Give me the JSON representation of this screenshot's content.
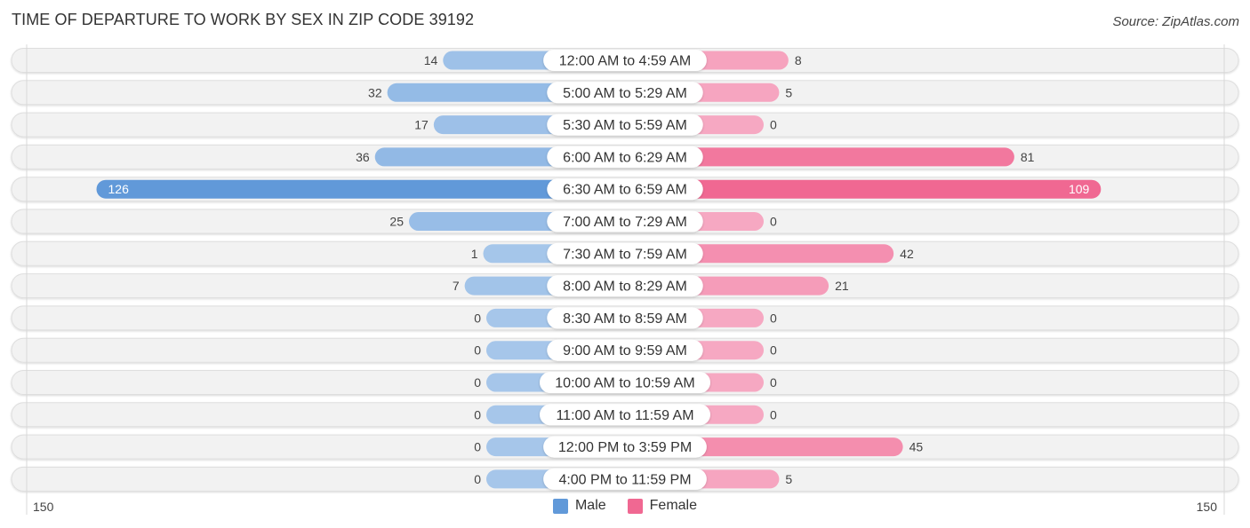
{
  "header": {
    "title": "TIME OF DEPARTURE TO WORK BY SEX IN ZIP CODE 39192",
    "source": "Source: ZipAtlas.com"
  },
  "colors": {
    "male_strong": "#6199d9",
    "male_light": "#a6c6ea",
    "female_strong": "#f06892",
    "female_light": "#f6a8c2",
    "row_bg": "#f2f2f2"
  },
  "legend": [
    {
      "label": "Male",
      "color": "#6199d9"
    },
    {
      "label": "Female",
      "color": "#f06892"
    }
  ],
  "chart_data": {
    "type": "bar",
    "orientation": "horizontal-diverging",
    "title": "TIME OF DEPARTURE TO WORK BY SEX IN ZIP CODE 39192",
    "categories": [
      "12:00 AM to 4:59 AM",
      "5:00 AM to 5:29 AM",
      "5:30 AM to 5:59 AM",
      "6:00 AM to 6:29 AM",
      "6:30 AM to 6:59 AM",
      "7:00 AM to 7:29 AM",
      "7:30 AM to 7:59 AM",
      "8:00 AM to 8:29 AM",
      "8:30 AM to 8:59 AM",
      "9:00 AM to 9:59 AM",
      "10:00 AM to 10:59 AM",
      "11:00 AM to 11:59 AM",
      "12:00 PM to 3:59 PM",
      "4:00 PM to 11:59 PM"
    ],
    "series": [
      {
        "name": "Male",
        "values": [
          14,
          32,
          17,
          36,
          126,
          25,
          1,
          7,
          0,
          0,
          0,
          0,
          0,
          0
        ]
      },
      {
        "name": "Female",
        "values": [
          8,
          5,
          0,
          81,
          109,
          0,
          42,
          21,
          0,
          0,
          0,
          0,
          45,
          5
        ]
      }
    ],
    "axis": {
      "left_label": "150",
      "right_label": "150",
      "range": [
        -150,
        150
      ]
    },
    "legend_position": "bottom-center",
    "grid": false
  }
}
